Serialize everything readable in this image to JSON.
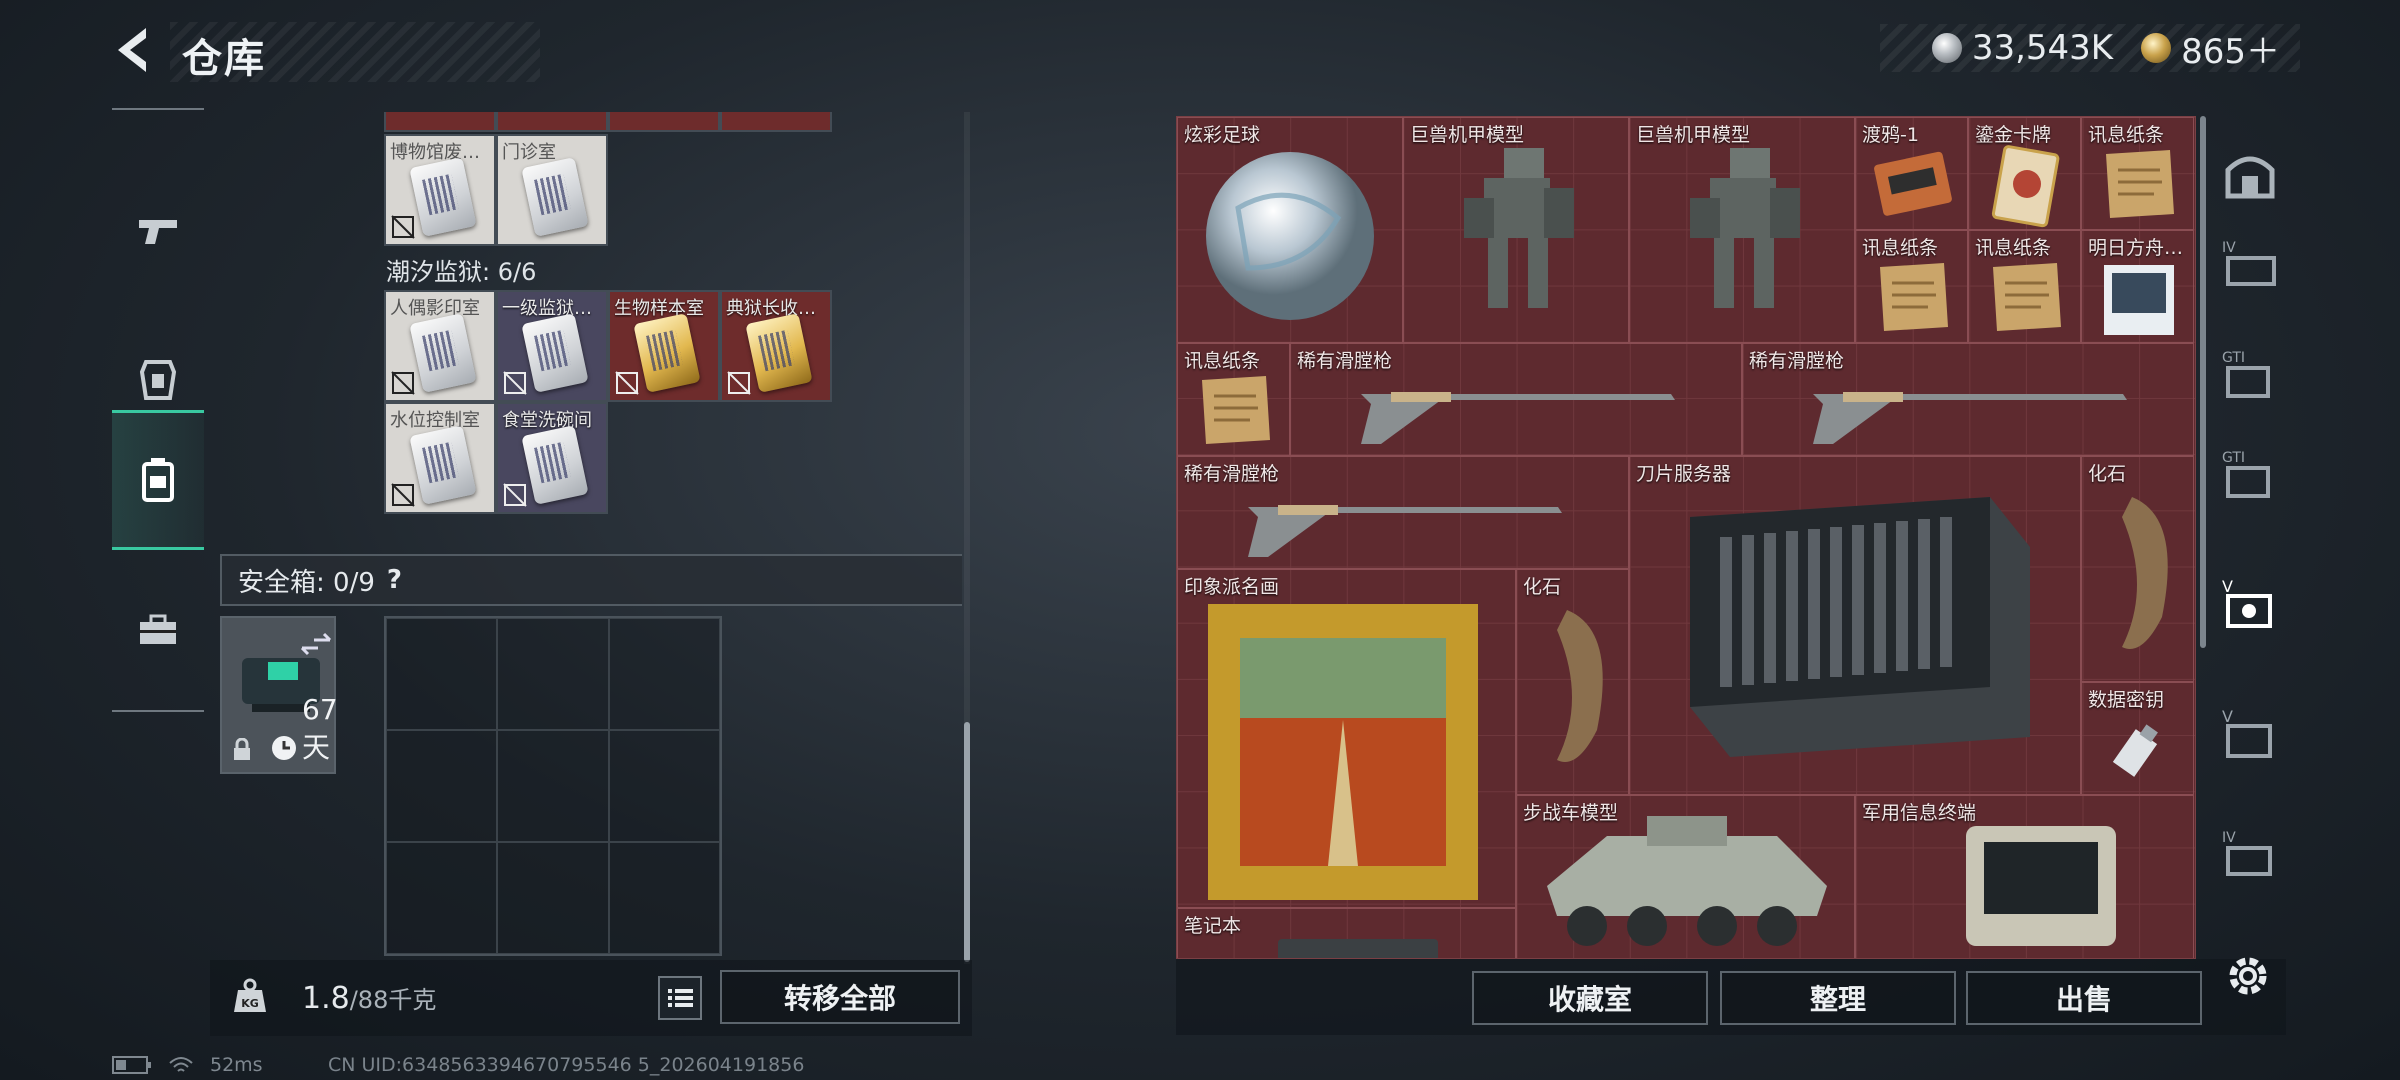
{
  "header": {
    "title": "仓库",
    "currency": [
      {
        "icon": "silver-coin-icon",
        "value": "33,543K"
      },
      {
        "icon": "gold-coin-icon",
        "value": "865＋"
      }
    ]
  },
  "rail_tabs": [
    {
      "icon": "pistol-icon",
      "active": false
    },
    {
      "icon": "armor-icon",
      "active": false
    },
    {
      "icon": "backpack-icon",
      "active": true
    },
    {
      "icon": "toolbox-icon",
      "active": false
    }
  ],
  "warehouse": {
    "museum_row": [
      {
        "label": "博物馆废…",
        "color": "white"
      },
      {
        "label": "门诊室",
        "color": "white"
      }
    ],
    "prison_section": "潮汐监狱: 6/6",
    "prison_cards": [
      {
        "label": "人偶影印室",
        "color": "white"
      },
      {
        "label": "一级监狱…",
        "color": "purple"
      },
      {
        "label": "生物样本室",
        "color": "red"
      },
      {
        "label": "典狱长收…",
        "color": "red"
      },
      {
        "label": "水位控制室",
        "color": "white"
      },
      {
        "label": "食堂洗碗间",
        "color": "purple"
      }
    ],
    "safe_label": "安全箱: 0/9",
    "safe_help": "?",
    "safe_timer": "67天"
  },
  "bottom_left": {
    "weight_current": "1.8",
    "weight_max": "/88千克",
    "transfer_all": "转移全部"
  },
  "container_items": [
    {
      "label": "炫彩足球"
    },
    {
      "label": "巨兽机甲模型"
    },
    {
      "label": "巨兽机甲模型"
    },
    {
      "label": "渡鸦-1"
    },
    {
      "label": "鎏金卡牌"
    },
    {
      "label": "讯息纸条"
    },
    {
      "label": "讯息纸条"
    },
    {
      "label": "讯息纸条"
    },
    {
      "label": "明日方舟…"
    },
    {
      "label": "讯息纸条"
    },
    {
      "label": "稀有滑膛枪"
    },
    {
      "label": "稀有滑膛枪"
    },
    {
      "label": "稀有滑膛枪"
    },
    {
      "label": "刀片服务器"
    },
    {
      "label": "化石"
    },
    {
      "label": "印象派名画"
    },
    {
      "label": "化石"
    },
    {
      "label": "数据密钥"
    },
    {
      "label": "步战车模型"
    },
    {
      "label": "军用信息终端"
    },
    {
      "label": "笔记本"
    }
  ],
  "right_buttons": {
    "collection": "收藏室",
    "sort": "整理",
    "sell": "出售"
  },
  "status": {
    "ping": "52ms",
    "uid": "CN UID:6348563394670795546 5_202604191856"
  },
  "colors": {
    "accent": "#39c9a1",
    "container_bg": "#5e2a2f",
    "panel_border": "#5c656d"
  }
}
